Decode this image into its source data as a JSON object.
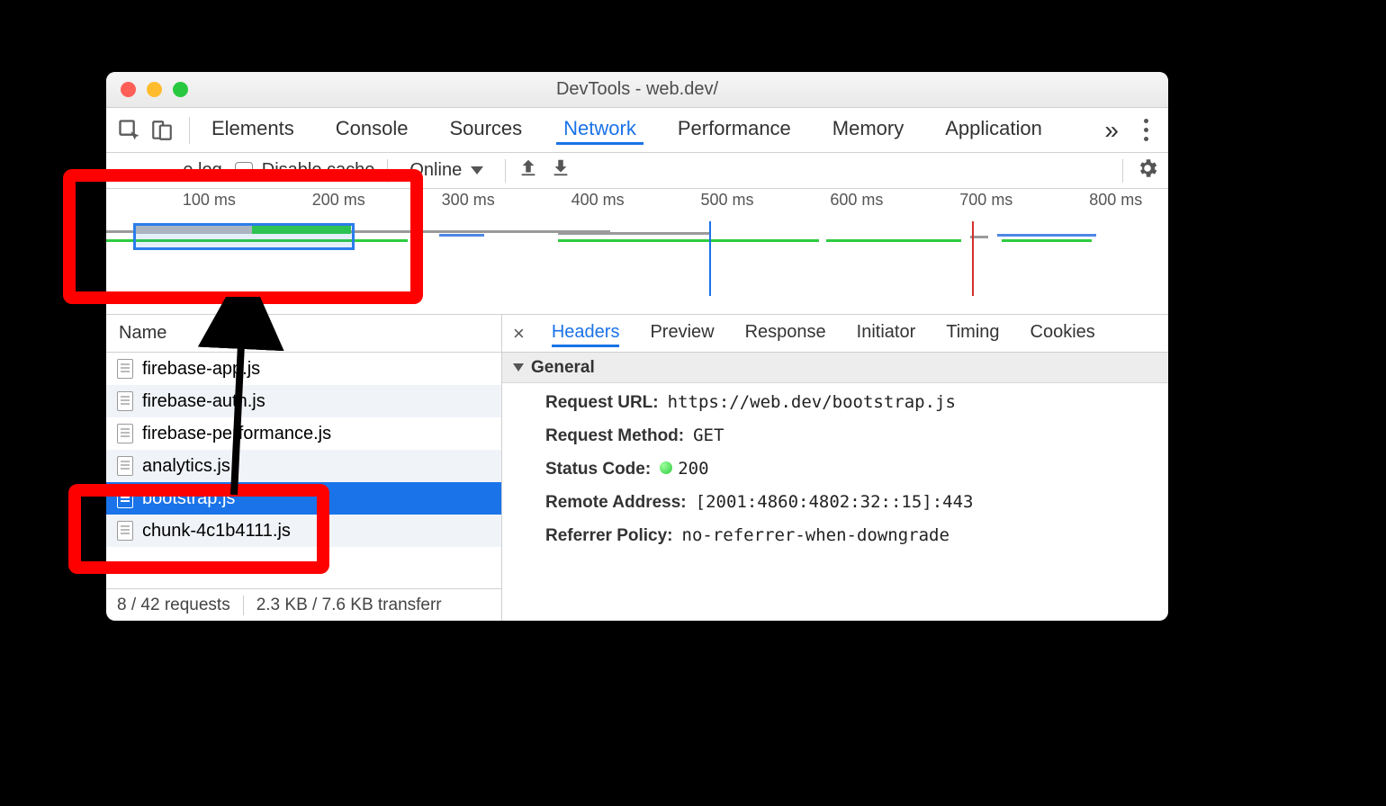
{
  "window": {
    "title": "DevTools - web.dev/"
  },
  "tabs": {
    "items": [
      "Elements",
      "Console",
      "Sources",
      "Network",
      "Performance",
      "Memory",
      "Application"
    ],
    "active": "Network",
    "overflow": "»"
  },
  "toolbar": {
    "preserve_log_label": "e log",
    "disable_cache_label": "Disable cache",
    "throttling_value": "Online"
  },
  "timeline": {
    "ticks": [
      "100 ms",
      "200 ms",
      "300 ms",
      "400 ms",
      "500 ms",
      "600 ms",
      "700 ms",
      "800 ms"
    ]
  },
  "name_column_header": "Name",
  "requests": [
    {
      "name": "firebase-app.js",
      "selected": false
    },
    {
      "name": "firebase-auth.js",
      "selected": false
    },
    {
      "name": "firebase-performance.js",
      "selected": false
    },
    {
      "name": "analytics.js",
      "selected": false
    },
    {
      "name": "bootstrap.js",
      "selected": true
    },
    {
      "name": "chunk-4c1b4111.js",
      "selected": false
    }
  ],
  "status": {
    "requests": "8 / 42 requests",
    "transfer": "2.3 KB / 7.6 KB transferr"
  },
  "detail_tabs": {
    "items": [
      "Headers",
      "Preview",
      "Response",
      "Initiator",
      "Timing",
      "Cookies"
    ],
    "active": "Headers"
  },
  "headers_section": {
    "title": "General",
    "rows": {
      "request_url": {
        "k": "Request URL:",
        "v": "https://web.dev/bootstrap.js"
      },
      "request_method": {
        "k": "Request Method:",
        "v": "GET"
      },
      "status_code": {
        "k": "Status Code:",
        "v": "200"
      },
      "remote_address": {
        "k": "Remote Address:",
        "v": "[2001:4860:4802:32::15]:443"
      },
      "referrer_policy": {
        "k": "Referrer Policy:",
        "v": "no-referrer-when-downgrade"
      }
    }
  }
}
